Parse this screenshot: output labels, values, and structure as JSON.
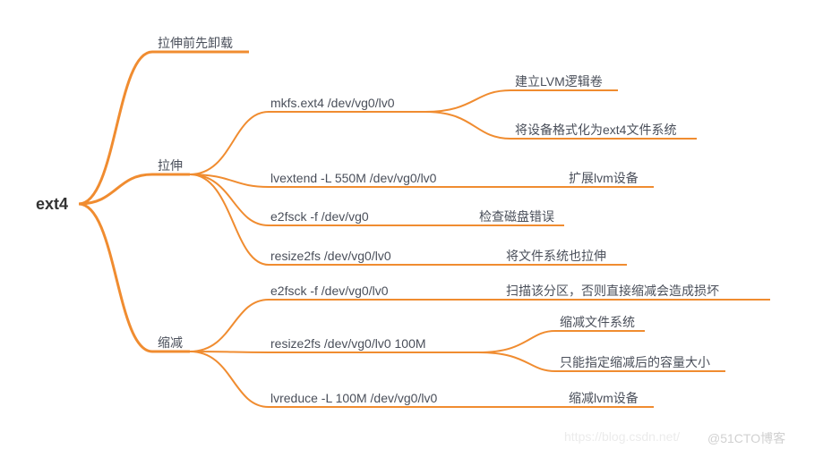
{
  "root": {
    "label": "ext4"
  },
  "b1": {
    "label": "拉伸前先卸载"
  },
  "b2": {
    "label": "拉伸",
    "c1": {
      "label": "mkfs.ext4 /dev/vg0/lv0",
      "g1": "建立LVM逻辑卷",
      "g2": "将设备格式化为ext4文件系统"
    },
    "c2": {
      "label": "lvextend -L 550M /dev/vg0/lv0",
      "g1": "扩展lvm设备"
    },
    "c3": {
      "label": "e2fsck -f /dev/vg0",
      "g1": "检查磁盘错误"
    },
    "c4": {
      "label": "resize2fs /dev/vg0/lv0",
      "g1": "将文件系统也拉伸"
    }
  },
  "b3": {
    "label": "缩减",
    "c1": {
      "label": "e2fsck -f /dev/vg0/lv0",
      "g1": "扫描该分区，否则直接缩减会造成损坏"
    },
    "c2": {
      "label": "resize2fs /dev/vg0/lv0 100M",
      "g1": "缩减文件系统",
      "g2": "只能指定缩减后的容量大小"
    },
    "c3": {
      "label": "lvreduce -L 100M /dev/vg0/lv0",
      "g1": "缩减lvm设备"
    }
  },
  "watermark1": "https://blog.csdn.net/",
  "watermark2": "@51CTO博客"
}
